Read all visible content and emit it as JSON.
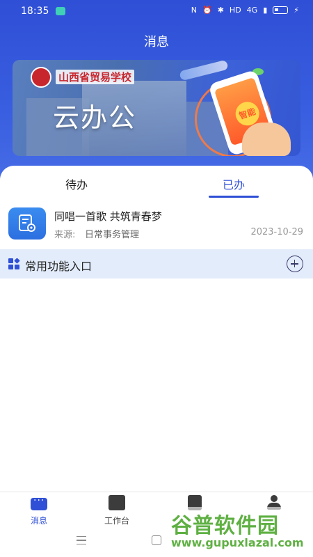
{
  "status_bar": {
    "time": "18:35",
    "network": "4G",
    "hd": "HD"
  },
  "header": {
    "title": "消息"
  },
  "banner": {
    "school_name": "山西省贸易学校",
    "main_text": "云办公",
    "badge": "智能"
  },
  "tabs": [
    {
      "label": "待办",
      "active": false
    },
    {
      "label": "已办",
      "active": true
    }
  ],
  "messages": [
    {
      "title": "同唱一首歌 共筑青春梦",
      "source_label": "来源:",
      "source": "日常事务管理",
      "date": "2023-10-29"
    }
  ],
  "section": {
    "title": "常用功能入口"
  },
  "bottom_nav": [
    {
      "label": "消息",
      "icon": "message-icon",
      "active": true
    },
    {
      "label": "工作台",
      "icon": "workbench-icon",
      "active": false
    },
    {
      "label": "",
      "icon": "contacts-icon",
      "active": false
    },
    {
      "label": "",
      "icon": "profile-icon",
      "active": false
    }
  ],
  "watermark": {
    "title": "谷普软件园",
    "url": "www.gupuxlazal.com"
  },
  "colors": {
    "primary": "#2f4fd6",
    "section_bg": "#e3ecfb",
    "accent_orange": "#ff5a2a"
  }
}
